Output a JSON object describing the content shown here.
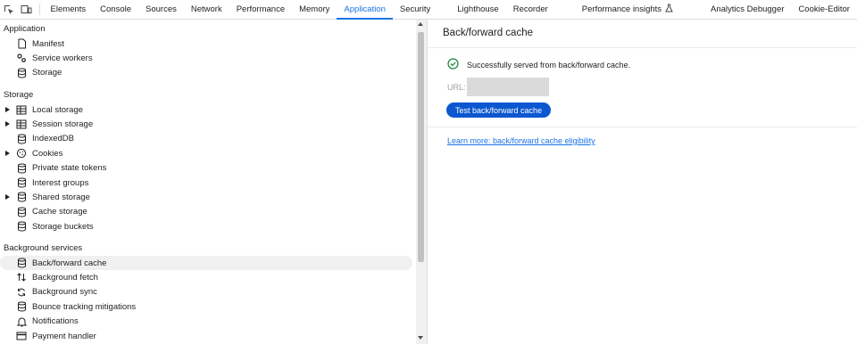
{
  "tabs": [
    {
      "label": "Elements",
      "active": false
    },
    {
      "label": "Console",
      "active": false
    },
    {
      "label": "Sources",
      "active": false
    },
    {
      "label": "Network",
      "active": false
    },
    {
      "label": "Performance",
      "active": false
    },
    {
      "label": "Memory",
      "active": false
    },
    {
      "label": "Application",
      "active": true
    },
    {
      "label": "Security",
      "active": false
    },
    {
      "label": "Lighthouse",
      "active": false
    },
    {
      "label": "Recorder",
      "active": false
    },
    {
      "label": "Performance insights",
      "active": false
    },
    {
      "label": "Analytics Debugger",
      "active": false
    },
    {
      "label": "Cookie-Editor",
      "active": false
    }
  ],
  "sidebar": {
    "sections": [
      {
        "title": "Application",
        "items": [
          {
            "label": "Manifest",
            "icon": "document-icon",
            "expandable": false
          },
          {
            "label": "Service workers",
            "icon": "gears-icon",
            "expandable": false
          },
          {
            "label": "Storage",
            "icon": "database-icon",
            "expandable": false
          }
        ]
      },
      {
        "title": "Storage",
        "items": [
          {
            "label": "Local storage",
            "icon": "table-icon",
            "expandable": true
          },
          {
            "label": "Session storage",
            "icon": "table-icon",
            "expandable": true
          },
          {
            "label": "IndexedDB",
            "icon": "database-icon",
            "expandable": false
          },
          {
            "label": "Cookies",
            "icon": "cookie-icon",
            "expandable": true
          },
          {
            "label": "Private state tokens",
            "icon": "database-icon",
            "expandable": false
          },
          {
            "label": "Interest groups",
            "icon": "database-icon",
            "expandable": false
          },
          {
            "label": "Shared storage",
            "icon": "database-icon",
            "expandable": true
          },
          {
            "label": "Cache storage",
            "icon": "database-icon",
            "expandable": false
          },
          {
            "label": "Storage buckets",
            "icon": "database-icon",
            "expandable": false
          }
        ]
      },
      {
        "title": "Background services",
        "items": [
          {
            "label": "Back/forward cache",
            "icon": "database-icon",
            "expandable": false,
            "selected": true
          },
          {
            "label": "Background fetch",
            "icon": "arrows-updown-icon",
            "expandable": false
          },
          {
            "label": "Background sync",
            "icon": "sync-icon",
            "expandable": false
          },
          {
            "label": "Bounce tracking mitigations",
            "icon": "database-icon",
            "expandable": false
          },
          {
            "label": "Notifications",
            "icon": "bell-icon",
            "expandable": false
          },
          {
            "label": "Payment handler",
            "icon": "card-icon",
            "expandable": false
          }
        ]
      }
    ]
  },
  "main": {
    "title": "Back/forward cache",
    "status_text": "Successfully served from back/forward cache.",
    "url_label": "URL:",
    "test_button": "Test back/forward cache",
    "learn_more": "Learn more: back/forward cache eligibility"
  },
  "colors": {
    "accent": "#1a73e8",
    "button": "#0b57d0",
    "success": "#188038",
    "selected_bg": "#f0f0f0"
  }
}
